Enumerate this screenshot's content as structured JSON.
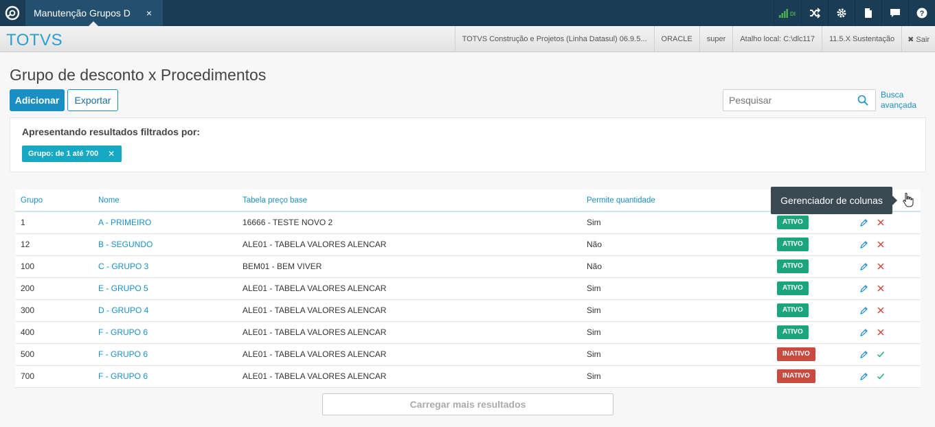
{
  "topbar": {
    "tab_label": "Manutenção Grupos D",
    "tab_close": "×",
    "signal_label": "DI"
  },
  "header": {
    "brand": "TOTVS",
    "items": [
      "TOTVS Construção e Projetos (Linha Datasul) 06.9.5...",
      "ORACLE",
      "super",
      "Atalho local: C:\\dlc117",
      "11.5.X Sustentação"
    ],
    "exit_label": "✖ Sair"
  },
  "page": {
    "title": "Grupo de desconto x Procedimentos",
    "add_button": "Adicionar",
    "export_button": "Exportar",
    "search_placeholder": "Pesquisar",
    "advanced_search_line1": "Busca",
    "advanced_search_line2": "avançada"
  },
  "filter": {
    "title": "Apresentando resultados filtrados por:",
    "chip_label": "Grupo: de 1 até 700",
    "chip_close": "✕"
  },
  "table": {
    "columns": [
      "Grupo",
      "Nome",
      "Tabela preço base",
      "Permite quantidade"
    ],
    "rows": [
      {
        "grupo": "1",
        "nome": "A - PRIMEIRO",
        "tabela": "16666 - TESTE NOVO 2",
        "permite": "Sim",
        "status": "ATIVO"
      },
      {
        "grupo": "12",
        "nome": "B - SEGUNDO",
        "tabela": "ALE01 - TABELA VALORES ALENCAR",
        "permite": "Não",
        "status": "ATIVO"
      },
      {
        "grupo": "100",
        "nome": "C - GRUPO 3",
        "tabela": "BEM01 - BEM VIVER",
        "permite": "Não",
        "status": "ATIVO"
      },
      {
        "grupo": "200",
        "nome": "E - GRUPO 5",
        "tabela": "ALE01 - TABELA VALORES ALENCAR",
        "permite": "Sim",
        "status": "ATIVO"
      },
      {
        "grupo": "300",
        "nome": "D - GRUPO 4",
        "tabela": "ALE01 - TABELA VALORES ALENCAR",
        "permite": "Sim",
        "status": "ATIVO"
      },
      {
        "grupo": "400",
        "nome": "F - GRUPO 6",
        "tabela": "ALE01 - TABELA VALORES ALENCAR",
        "permite": "Sim",
        "status": "ATIVO"
      },
      {
        "grupo": "500",
        "nome": "F - GRUPO 6",
        "tabela": "ALE01 - TABELA VALORES ALENCAR",
        "permite": "Sim",
        "status": "INATIVO"
      },
      {
        "grupo": "700",
        "nome": "F - GRUPO 6",
        "tabela": "ALE01 - TABELA VALORES ALENCAR",
        "permite": "Sim",
        "status": "INATIVO"
      }
    ]
  },
  "tooltip": {
    "text": "Gerenciador de colunas"
  },
  "load_more": "Carregar mais resultados",
  "colors": {
    "topbar": "#1a3c55",
    "accent": "#1a8fc4",
    "active_badge": "#1aa57d",
    "inactive_badge": "#c94a3f",
    "chip": "#17a9c4"
  }
}
